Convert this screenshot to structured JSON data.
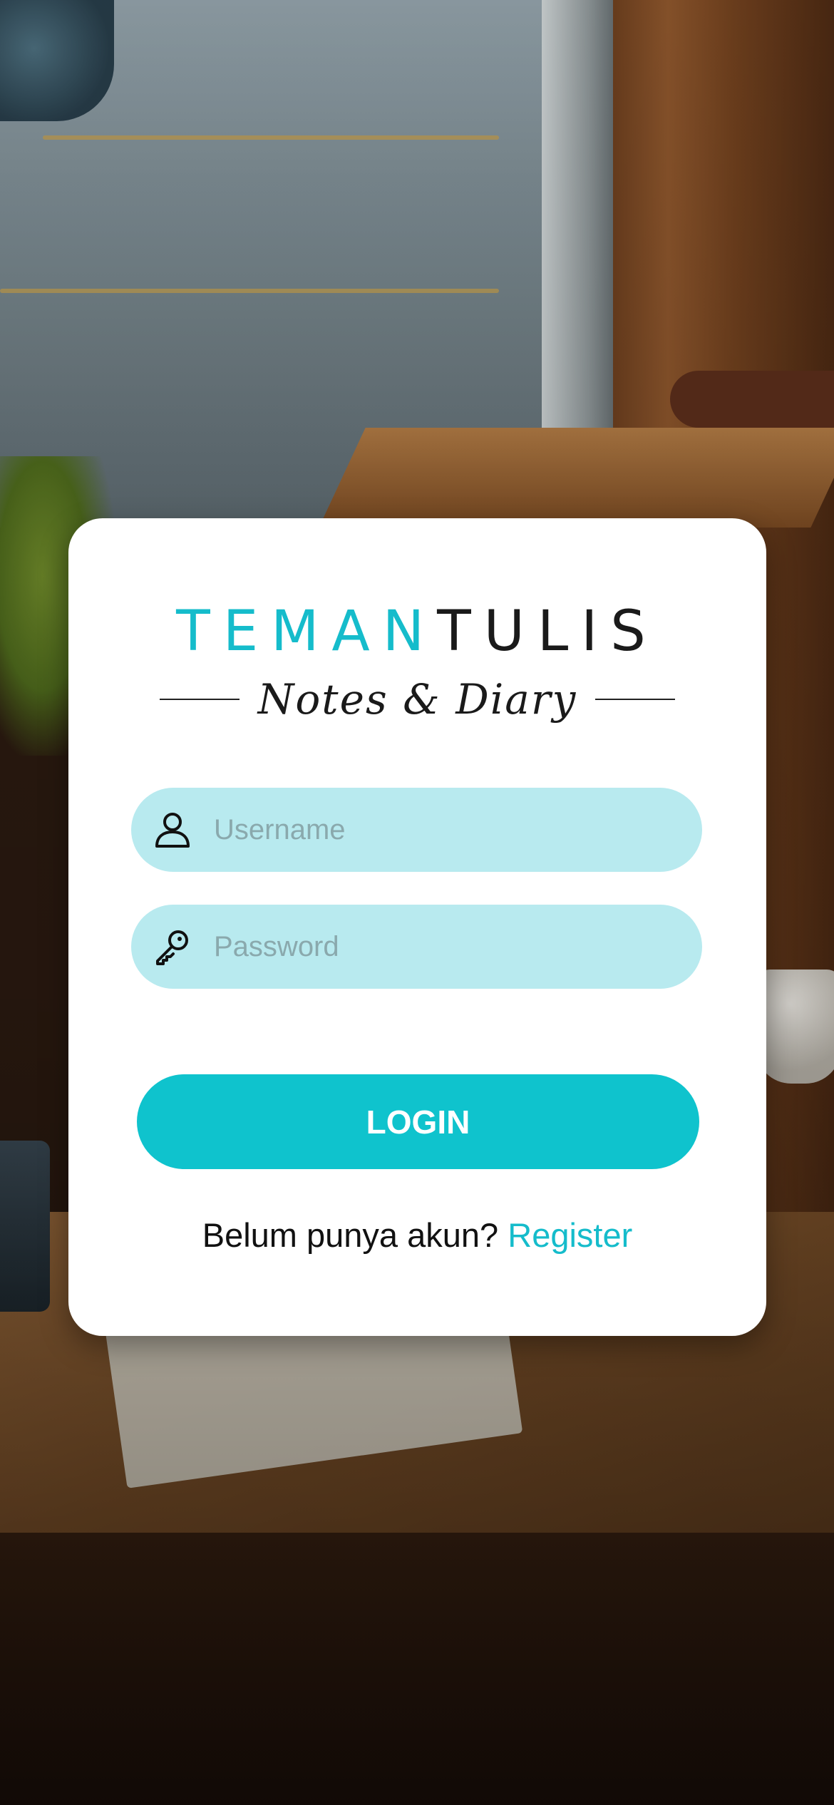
{
  "logo": {
    "title_part1": "TEMAN",
    "title_part2": "TULIS",
    "subtitle": "Notes & Diary"
  },
  "form": {
    "username": {
      "placeholder": "Username",
      "value": "",
      "icon": "user-icon"
    },
    "password": {
      "placeholder": "Password",
      "value": "",
      "icon": "key-icon"
    },
    "login_label": "LOGIN"
  },
  "register": {
    "prompt": "Belum punya akun?",
    "link_label": "Register"
  },
  "colors": {
    "accent": "#0fc3cd",
    "field_background": "#b8eaef",
    "link": "#15bccb"
  }
}
